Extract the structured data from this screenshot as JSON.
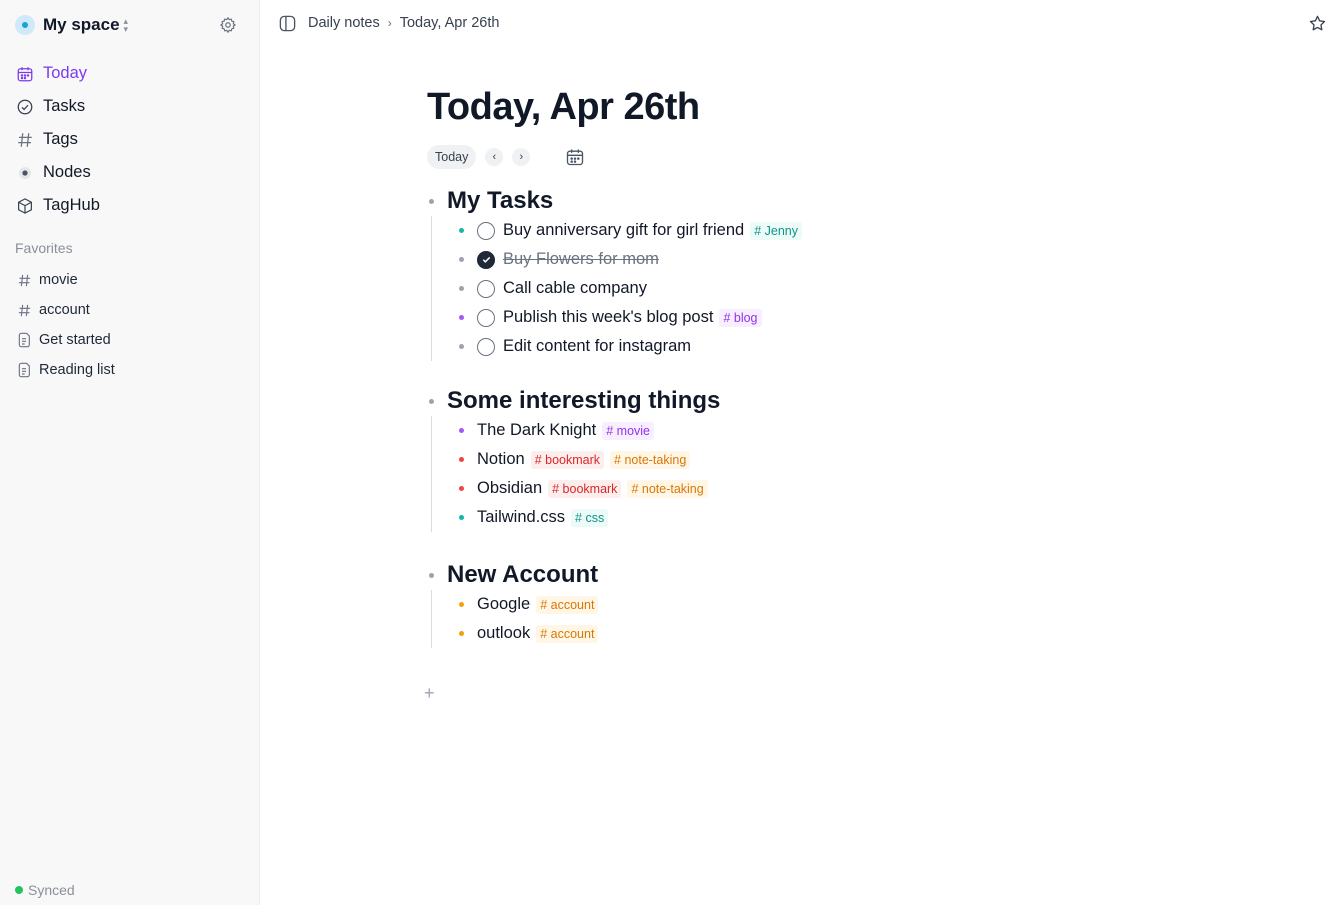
{
  "space": {
    "name": "My space"
  },
  "nav": [
    {
      "label": "Today",
      "icon": "calendar-icon"
    },
    {
      "label": "Tasks",
      "icon": "check-circle-icon"
    },
    {
      "label": "Tags",
      "icon": "hash-icon"
    },
    {
      "label": "Nodes",
      "icon": "node-icon"
    },
    {
      "label": "TagHub",
      "icon": "cube-icon"
    }
  ],
  "favorites": {
    "title": "Favorites",
    "items": [
      {
        "label": "movie",
        "icon": "hash-icon"
      },
      {
        "label": "account",
        "icon": "hash-icon"
      },
      {
        "label": "Get started",
        "icon": "page-icon"
      },
      {
        "label": "Reading list",
        "icon": "page-icon"
      }
    ]
  },
  "status": {
    "synced": "Synced"
  },
  "breadcrumb": {
    "parent": "Daily notes",
    "current": "Today, Apr 26th"
  },
  "page": {
    "title": "Today, Apr 26th",
    "today_button": "Today"
  },
  "sections": [
    {
      "title": "My Tasks",
      "rows": [
        {
          "text": "Buy anniversary gift for girl friend",
          "task": true,
          "done": false,
          "bullet": "#14b8a6",
          "tags": [
            {
              "label": "# Jenny",
              "color": "#0d9488",
              "bg": "#ecfbf8"
            }
          ]
        },
        {
          "text": "Buy Flowers for mom",
          "task": true,
          "done": true,
          "bullet": "#9ca3af",
          "tags": []
        },
        {
          "text": "Call cable company",
          "task": true,
          "done": false,
          "bullet": "#9ca3af",
          "tags": []
        },
        {
          "text": "Publish this week's blog post",
          "task": true,
          "done": false,
          "bullet": "#a855f7",
          "tags": [
            {
              "label": "# blog",
              "color": "#9333ea",
              "bg": "#f7efff"
            }
          ]
        },
        {
          "text": "Edit content for instagram",
          "task": true,
          "done": false,
          "bullet": "#9ca3af",
          "tags": []
        }
      ]
    },
    {
      "title": "Some interesting things",
      "rows": [
        {
          "text": "The Dark Knight",
          "task": false,
          "bullet": "#a855f7",
          "tags": [
            {
              "label": "# movie",
              "color": "#9333ea",
              "bg": "#f7efff"
            }
          ]
        },
        {
          "text": "Notion",
          "task": false,
          "bullet": "#ef4444",
          "tags": [
            {
              "label": "# bookmark",
              "color": "#dc2626",
              "bg": "#fdeeee"
            },
            {
              "label": "# note-taking",
              "color": "#d97706",
              "bg": "#fff6e6"
            }
          ]
        },
        {
          "text": "Obsidian",
          "task": false,
          "bullet": "#ef4444",
          "tags": [
            {
              "label": "# bookmark",
              "color": "#dc2626",
              "bg": "#fdeeee"
            },
            {
              "label": "# note-taking",
              "color": "#d97706",
              "bg": "#fff6e6"
            }
          ]
        },
        {
          "text": "Tailwind.css",
          "task": false,
          "bullet": "#14b8a6",
          "tags": [
            {
              "label": "# css",
              "color": "#0d9488",
              "bg": "#ecfbf8"
            }
          ]
        }
      ]
    },
    {
      "title": "New Account",
      "rows": [
        {
          "text": "Google",
          "task": false,
          "bullet": "#f59e0b",
          "tags": [
            {
              "label": "# account",
              "color": "#d97706",
              "bg": "#fff6e6"
            }
          ]
        },
        {
          "text": "outlook",
          "task": false,
          "bullet": "#f59e0b",
          "tags": [
            {
              "label": "# account",
              "color": "#d97706",
              "bg": "#fff6e6"
            }
          ]
        }
      ]
    }
  ],
  "colors": {
    "accent": "#7c3aed",
    "synced": "#22c55e"
  }
}
